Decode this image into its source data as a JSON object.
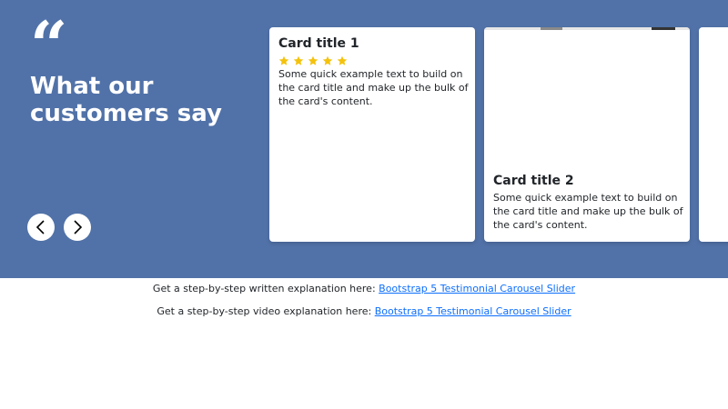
{
  "hero": {
    "quote_glyph": "“",
    "title": "What our customers say",
    "prev_icon": "chevron-left-icon",
    "next_icon": "chevron-right-icon",
    "background_color": "#5172a8"
  },
  "cards": [
    {
      "title": "Card title 1",
      "rating": 5,
      "rating_max": 5,
      "star_color": "#f4c20d",
      "text": "Some quick example text to build on the card title and make up the bulk of the card's content."
    },
    {
      "title": "Card title 2",
      "text": "Some quick example text to build on the card title and make up the bulk of the card's content."
    }
  ],
  "footer": {
    "written_prefix": "Get a step-by-step written explanation here:",
    "written_link": "Bootstrap 5 Testimonial Carousel Slider",
    "video_prefix": "Get a step-by-step video explanation here:",
    "video_link": "Bootstrap 5 Testimonial Carousel Slider",
    "link_color": "#0d6efd"
  }
}
